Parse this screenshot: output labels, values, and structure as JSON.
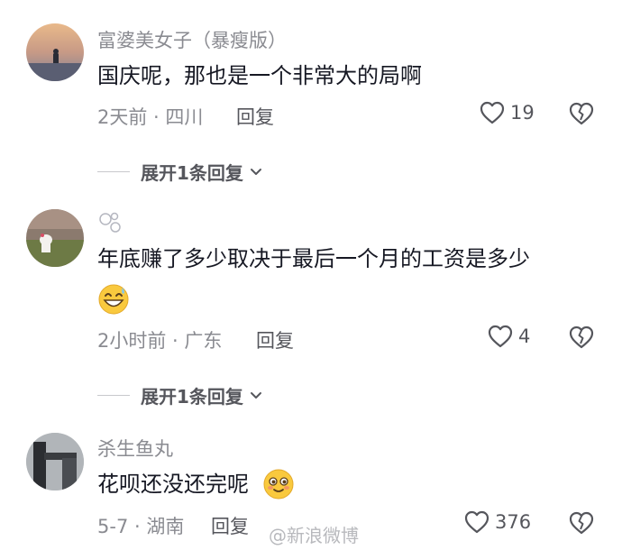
{
  "comments": [
    {
      "username": "富婆美女子（暴瘦版）",
      "text": "国庆呢，那也是一个非常大的局啊",
      "meta": "2天前 · 四川",
      "reply_label": "回复",
      "likes": "19",
      "expand_label": "展开1条回复"
    },
    {
      "username": "",
      "text": "年底赚了多少取决于最后一个月的工资是多少",
      "meta": "2小时前 · 广东",
      "reply_label": "回复",
      "likes": "4",
      "expand_label": "展开1条回复"
    },
    {
      "username": "杀生鱼丸",
      "text": "花呗还没还完呢",
      "meta": "5-7 · 湖南",
      "reply_label": "回复",
      "likes": "376"
    }
  ],
  "watermark": "@新浪微博",
  "colors": {
    "text": "#161823",
    "secondary": "#8a8b91",
    "action": "#55565c"
  }
}
